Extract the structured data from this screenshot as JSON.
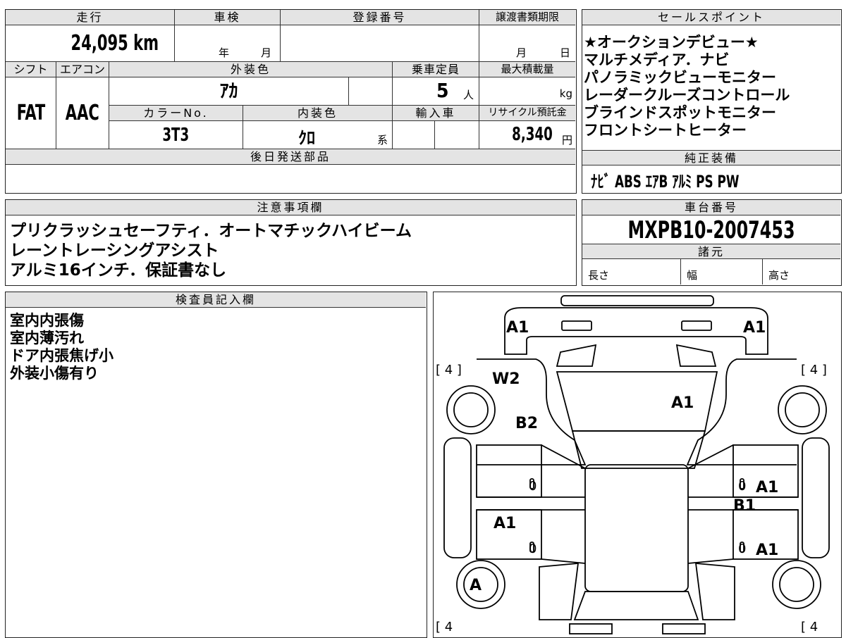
{
  "mileage": {
    "label": "走行",
    "value": "24,095 km"
  },
  "inspection": {
    "label": "車検",
    "year_unit": "年",
    "month_unit": "月"
  },
  "registration": {
    "label": "登録番号"
  },
  "transfer_deadline": {
    "label": "譲渡書類期限",
    "month_unit": "月",
    "day_unit": "日"
  },
  "shift": {
    "label": "シフト",
    "value": "FAT"
  },
  "aircon": {
    "label": "エアコン",
    "value": "AAC"
  },
  "exterior_color": {
    "label": "外装色",
    "value": "ｱｶ"
  },
  "capacity": {
    "label": "乗車定員",
    "value": "5",
    "unit": "人"
  },
  "max_load": {
    "label": "最大積載量",
    "unit": "kg"
  },
  "color_no": {
    "label": "カラーNo.",
    "value": "3T3"
  },
  "interior_color": {
    "label": "内装色",
    "value": "ｸﾛ",
    "suffix": "系"
  },
  "import": {
    "label": "輸入車"
  },
  "recycle_fee": {
    "label": "リサイクル預託金",
    "value": "8,340",
    "unit": "円"
  },
  "later_parts": {
    "label": "後日発送部品"
  },
  "sales_points": {
    "label": "セールスポイント",
    "items": [
      "★オークションデビュー★",
      "マルチメディア．ナビ",
      "パノラミックビューモニター",
      "レーダークルーズコントロール",
      "ブラインドスポットモニター",
      "フロントシートヒーター"
    ]
  },
  "standard_equipment": {
    "label": "純正装備",
    "value": "ﾅﾋﾞ ABS ｴｱB ｱﾙﾐ PS PW"
  },
  "notes": {
    "label": "注意事項欄",
    "lines": [
      "プリクラッシュセーフティ．オートマチックハイビーム",
      "レーントレーシングアシスト",
      "アルミ16インチ．保証書なし"
    ]
  },
  "chassis": {
    "label": "車台番号",
    "value": "MXPB10-2007453"
  },
  "specs": {
    "label": "諸元",
    "length": "長さ",
    "width": "幅",
    "height": "高さ"
  },
  "inspector": {
    "label": "検査員記入欄",
    "lines": [
      "室内内張傷",
      "室内薄汚れ",
      "ドア内張焦げ小",
      "外装小傷有り"
    ]
  },
  "damage": {
    "bracket_tl": "[ 4 ]",
    "bracket_tr": "[ 4 ]",
    "bracket_bl": "[ 4",
    "bracket_br": "[ 4",
    "codes": [
      "A1",
      "A1",
      "W2",
      "A1",
      "B2",
      "0",
      "A1",
      "A1",
      "0",
      "B1",
      "0",
      "A1",
      "0",
      "A1",
      "A"
    ]
  }
}
